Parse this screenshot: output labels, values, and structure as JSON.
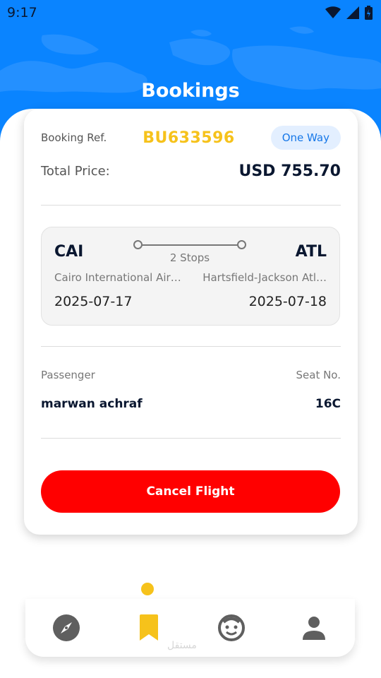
{
  "status_bar": {
    "time": "9:17"
  },
  "page": {
    "title": "Bookings"
  },
  "booking": {
    "ref_label": "Booking Ref.",
    "ref_value": "BU633596",
    "trip_type": "One Way",
    "price_label": "Total Price:",
    "price_value": "USD 755.70"
  },
  "flight": {
    "origin_code": "CAI",
    "origin_airport": "Cairo International Air…",
    "origin_date": "2025-07-17",
    "destination_code": "ATL",
    "destination_airport": "Hartsfield-Jackson Atl…",
    "destination_date": "2025-07-18",
    "stops": "2 Stops"
  },
  "passenger": {
    "passenger_label": "Passenger",
    "passenger_name": "marwan achraf",
    "seat_label": "Seat No.",
    "seat_value": "16C"
  },
  "actions": {
    "cancel_label": "Cancel Flight"
  },
  "bottom_nav": {
    "items": [
      {
        "icon": "compass-icon",
        "active": false
      },
      {
        "icon": "bookmark-icon",
        "active": true
      },
      {
        "icon": "smiley-face-icon",
        "active": false
      },
      {
        "icon": "person-icon",
        "active": false
      }
    ]
  },
  "watermark": {
    "text": "مستقل"
  },
  "colors": {
    "header": "#0a84ff",
    "accent": "#f6c21b",
    "danger": "#ff0000",
    "badge_bg": "#e3efff",
    "badge_text": "#1677e8",
    "dark_text": "#0a1730"
  }
}
